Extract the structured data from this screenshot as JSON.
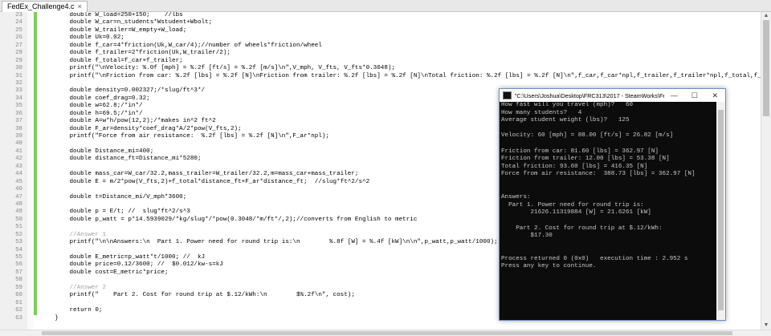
{
  "tab": {
    "label": "FedEx_Challenge4.c",
    "close": "×"
  },
  "code_lines": [
    {
      "n": "23",
      "text": "        double W_load=250+150;    //lbs",
      "color": "#000"
    },
    {
      "n": "24",
      "text": "        double W_car=n_students*Wstudent+Wbolt;",
      "color": "#000"
    },
    {
      "n": "25",
      "text": "        double W_trailer=W_empty+W_load;",
      "color": "#000"
    },
    {
      "n": "26",
      "text": "        double Uk=0.02;",
      "color": "#000"
    },
    {
      "n": "27",
      "text": "        double f_car=4*friction(Uk,W_car/4);//number of wheels*friction/wheel",
      "color": "#000"
    },
    {
      "n": "28",
      "text": "        double f_trailer=2*friction(Uk,W_trailer/2);",
      "color": "#000"
    },
    {
      "n": "29",
      "text": "        double f_total=f_car+f_trailer;",
      "color": "#000"
    },
    {
      "n": "30",
      "text": "        printf(\"\\nVelocity: %.0f [mph] = %.2f [ft/s] = %.2f [m/s]\\n\",V_mph, V_fts, V_fts*0.3048);",
      "color": "#000"
    },
    {
      "n": "31",
      "text": "        printf(\"\\nFriction from car: %.2f [lbs] = %.2f [N]\\nFriction from trailer: %.2f [lbs] = %.2f [N]\\nTotal friction: %.2f [lbs] = %.2f [N]\\n\",f_car,f_car*npl,f_trailer,f_trailer*npl,f_total,f_total*",
      "color": "#000"
    },
    {
      "n": "32",
      "text": "",
      "color": "#000"
    },
    {
      "n": "33",
      "text": "        double density=0.002327;/*slug/ft^3*/",
      "color": "#000"
    },
    {
      "n": "34",
      "text": "        double coef_drag=0.32;",
      "color": "#000"
    },
    {
      "n": "35",
      "text": "        double w=62.8;/*in*/",
      "color": "#000"
    },
    {
      "n": "36",
      "text": "        double h=69.5;/*in*/",
      "color": "#000"
    },
    {
      "n": "37",
      "text": "        double A=w*h/pow(12,2);/*makes in^2 ft^2",
      "color": "#000"
    },
    {
      "n": "38",
      "text": "        double F_ar=density*coef_drag*A/2*pow(V_fts,2);",
      "color": "#000"
    },
    {
      "n": "39",
      "text": "        printf(\"Force from air resistance:  %.2f [lbs] = %.2f [N]\\n\",F_ar*npl);",
      "color": "#000"
    },
    {
      "n": "40",
      "text": "",
      "color": "#000"
    },
    {
      "n": "41",
      "text": "        double Distance_mi=400;",
      "color": "#000"
    },
    {
      "n": "42",
      "text": "        double distance_ft=Distance_mi*5280;",
      "color": "#000"
    },
    {
      "n": "43",
      "text": "",
      "color": "#000"
    },
    {
      "n": "44",
      "text": "        double mass_car=W_car/32.2,mass_trailer=W_trailer/32.2,m=mass_car+mass_trailer;",
      "color": "#000"
    },
    {
      "n": "45",
      "text": "        double E = m/2*pow(V_fts,2)+f_total*distance_ft+F_ar*distance_ft;  //slug*ft^2/s^2",
      "color": "#000"
    },
    {
      "n": "46",
      "text": "",
      "color": "#000"
    },
    {
      "n": "47",
      "text": "        double t=Distance_mi/V_mph*3600;",
      "color": "#000"
    },
    {
      "n": "48",
      "text": "",
      "color": "#000"
    },
    {
      "n": "49",
      "text": "        double p = E/t; //  slug*ft^2/s^3",
      "color": "#000"
    },
    {
      "n": "50",
      "text": "        double p_watt = p*14.5939029/*kg/slug*/*pow(0.3048/*m/ft*/,2);//converts from English to metric",
      "color": "#000"
    },
    {
      "n": "51",
      "text": "",
      "color": "#000"
    },
    {
      "n": "52",
      "text": "        //Answer 1",
      "color": "#a0a0a0"
    },
    {
      "n": "53",
      "text": "        printf(\"\\n\\nAnswers:\\n  Part 1. Power need for round trip is:\\n        %.8f [W] = %.4f [kW]\\n\\n\",p_watt,p_watt/1000);",
      "color": "#000"
    },
    {
      "n": "54",
      "text": "",
      "color": "#000"
    },
    {
      "n": "55",
      "text": "        double E_metric=p_watt*t/1000; //  kJ",
      "color": "#000"
    },
    {
      "n": "56",
      "text": "        double price=0.12/3600; //  $0.012/kw-s=kJ",
      "color": "#000"
    },
    {
      "n": "57",
      "text": "        double cost=E_metric*price;",
      "color": "#000"
    },
    {
      "n": "58",
      "text": "",
      "color": "#000"
    },
    {
      "n": "59",
      "text": "        //Answer 2",
      "color": "#a0a0a0"
    },
    {
      "n": "60",
      "text": "        printf(\"    Part 2. Cost for round trip at $.12/kWh:\\n        $%.2f\\n\", cost);",
      "color": "#000"
    },
    {
      "n": "61",
      "text": "",
      "color": "#000"
    },
    {
      "n": "62",
      "text": "        return 0;",
      "color": "#000"
    },
    {
      "n": "63",
      "text": "    }",
      "color": "#000"
    }
  ],
  "console": {
    "title": "\"C:\\Users\\Joshua\\Desktop\\FRC313\\2017 - SteamWorks\\FedEx...",
    "minimize": "—",
    "maximize": "☐",
    "close": "✕",
    "lines": [
      "How fast will you travel (mph)?   60",
      "How many students?   4",
      "Average student weight (lbs)?   125",
      "",
      "Velocity: 60 [mph] = 88.00 [ft/s] = 26.82 [m/s]",
      "",
      "Friction from car: 81.60 [lbs] = 362.97 [N]",
      "Friction from trailer: 12.00 [lbs] = 53.38 [N]",
      "Total friction: 93.60 [lbs] = 416.35 [N]",
      "Force from air resistance:  388.73 [lbs] = 362.97 [N]",
      "",
      "",
      "Answers:",
      "  Part 1. Power need for round trip is:",
      "        21626.11319884 [W] = 21.6261 [kW]",
      "",
      "    Part 2. Cost for round trip at $.12/kWh:",
      "        $17.30",
      "",
      "",
      "Process returned 0 (0x0)   execution time : 2.952 s",
      "Press any key to continue."
    ]
  }
}
